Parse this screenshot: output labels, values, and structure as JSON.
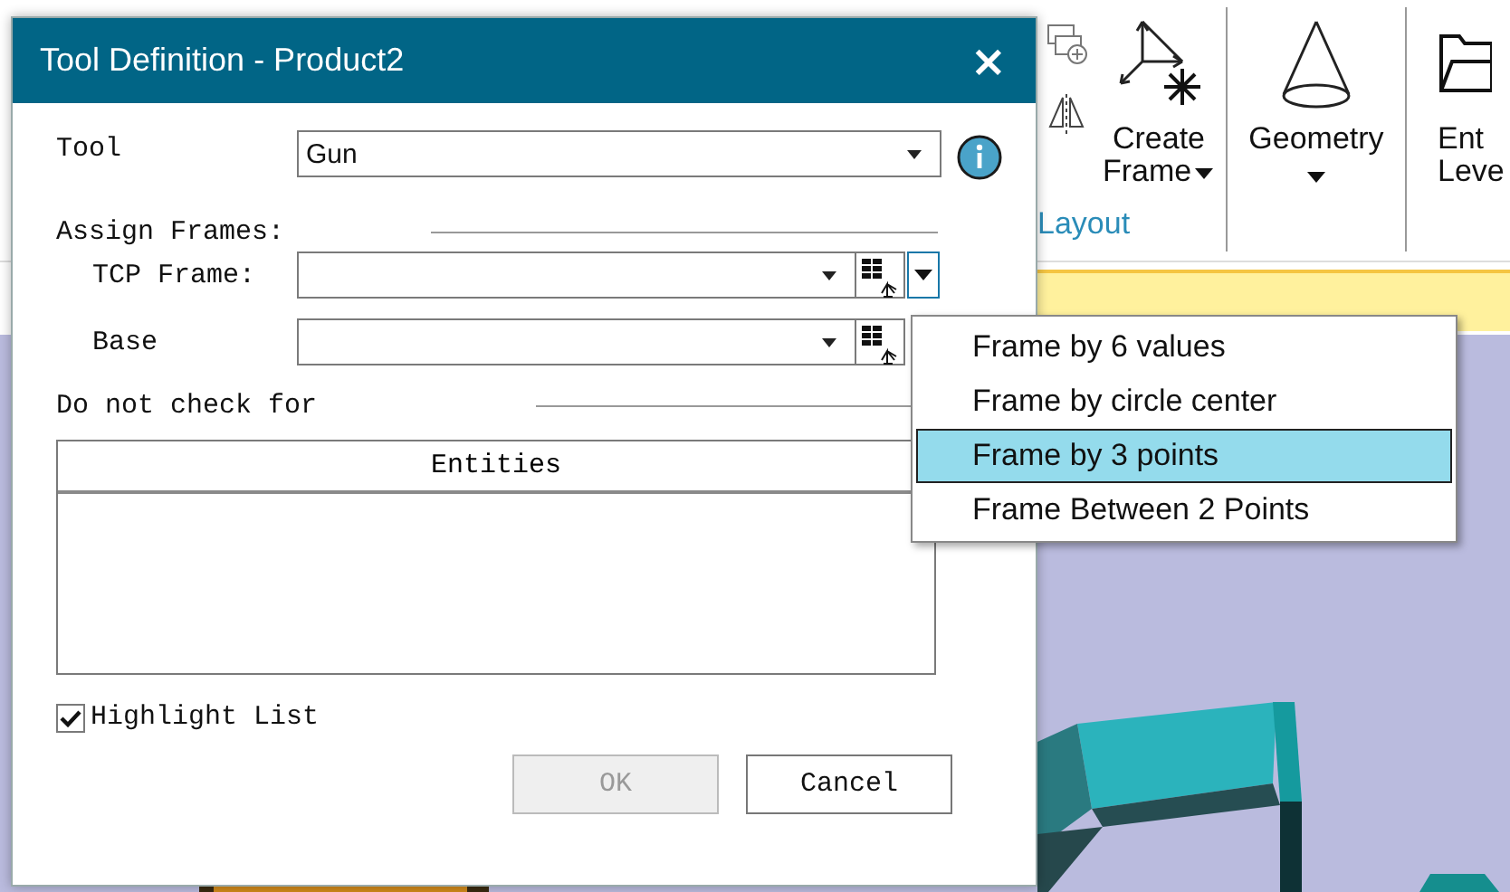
{
  "ribbon": {
    "group_label": "Layout",
    "buttons": [
      {
        "kind": "split",
        "lines": [
          "Create",
          "Frame"
        ]
      },
      {
        "kind": "dropdown",
        "lines": [
          "Geometry"
        ]
      },
      {
        "kind": "plain",
        "lines": [
          "Ent",
          "Leve"
        ]
      }
    ]
  },
  "dialog": {
    "title": "Tool Definition - Product2",
    "close": "×",
    "tool": {
      "label": "Tool",
      "value": "Gun"
    },
    "assign_frames": {
      "heading": "Assign Frames:",
      "rows": [
        {
          "label": "TCP Frame:",
          "menu_open": true
        },
        {
          "label": "Base",
          "menu_open": false
        }
      ]
    },
    "do_not_check": {
      "heading": "Do not check for",
      "columns": [
        "Entities"
      ]
    },
    "highlight_list": {
      "label": "Highlight List",
      "checked": true
    },
    "buttons": [
      {
        "label": "OK",
        "disabled": true
      },
      {
        "label": "Cancel",
        "disabled": false
      }
    ]
  },
  "menu": {
    "items": [
      {
        "label": "Frame by 6 values",
        "selected": false
      },
      {
        "label": "Frame by circle center",
        "selected": false
      },
      {
        "label": "Frame by 3 points",
        "selected": true
      },
      {
        "label": "Frame Between 2 Points",
        "selected": false
      }
    ]
  }
}
